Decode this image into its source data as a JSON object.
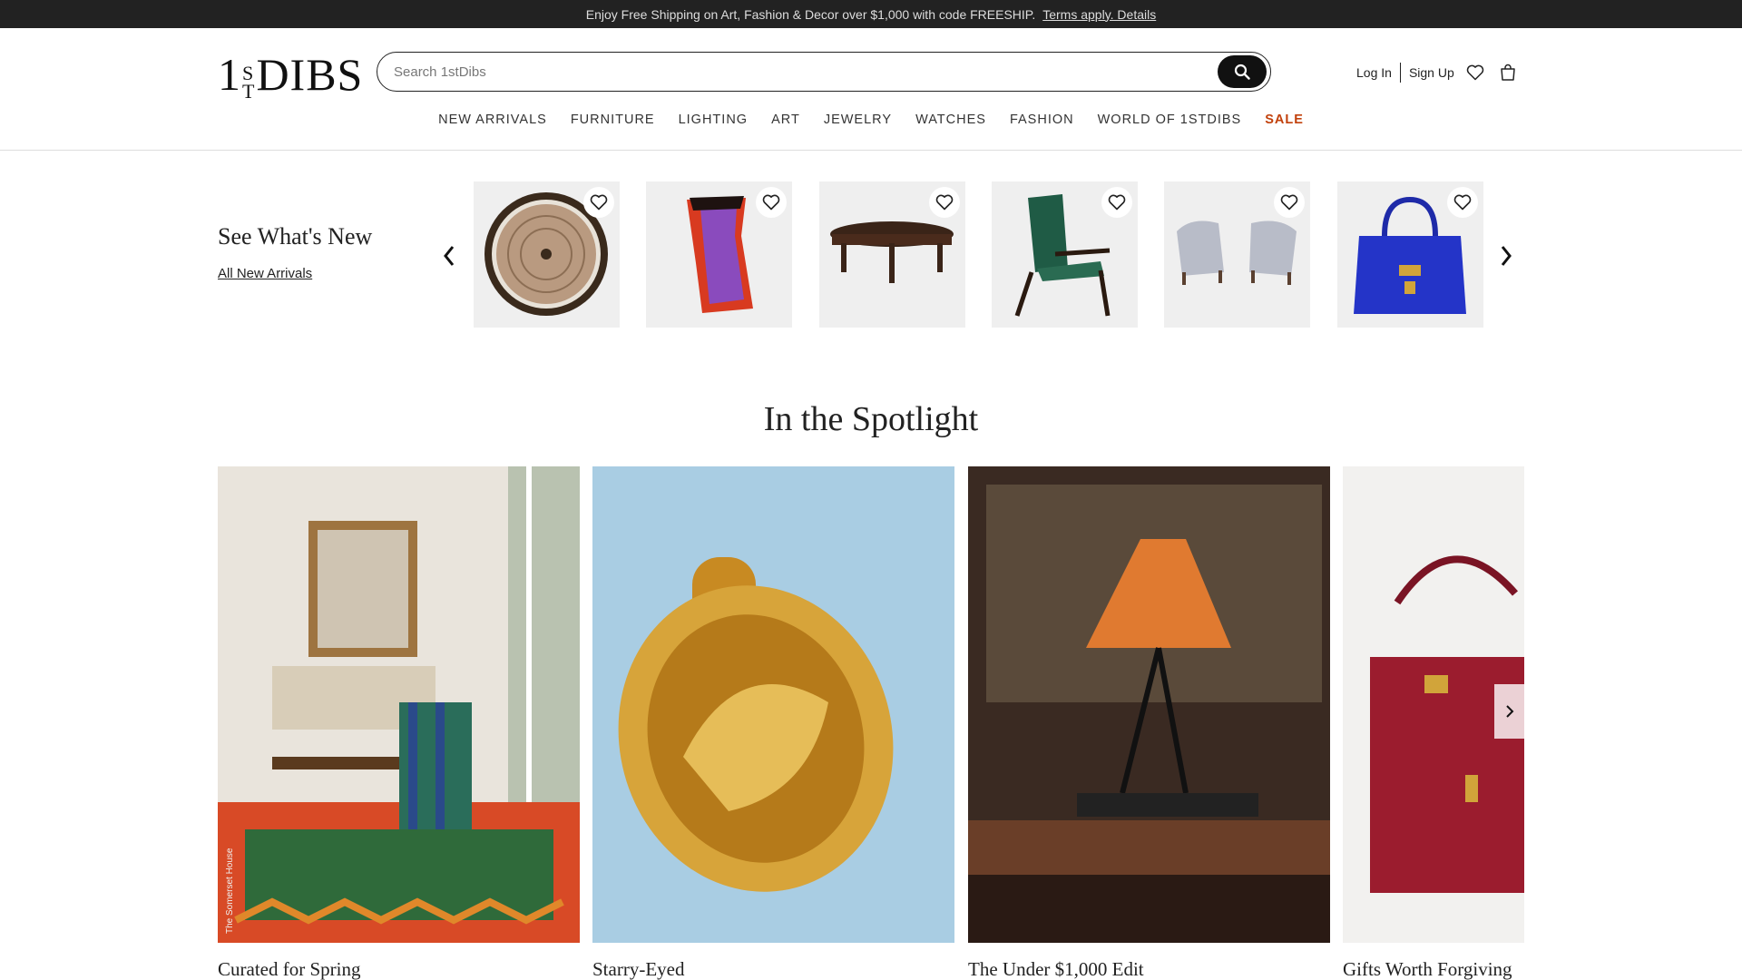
{
  "promo": {
    "text": "Enjoy Free Shipping on Art, Fashion & Decor over $1,000 with code FREESHIP.",
    "link": "Terms apply. Details"
  },
  "header": {
    "logo_main": "1",
    "logo_sup_top": "S",
    "logo_sup_bottom": "T",
    "logo_rest": "DIBS",
    "search_placeholder": "Search 1stDibs",
    "login": "Log In",
    "signup": "Sign Up"
  },
  "nav": [
    "NEW ARRIVALS",
    "FURNITURE",
    "LIGHTING",
    "ART",
    "JEWELRY",
    "WATCHES",
    "FASHION",
    "WORLD OF 1STDIBS",
    "SALE"
  ],
  "new_arrivals": {
    "title": "See What's New",
    "link": "All New Arrivals",
    "items": [
      "Round carved wall plate",
      "Red and purple ceramic vase",
      "Oval dark wood coffee table",
      "Green leather lounge chair",
      "Pair of gray striped armchairs",
      "Blue leather handbag"
    ]
  },
  "spotlight": {
    "title": "In the Spotlight",
    "cards": [
      {
        "label": "Curated for Spring",
        "credit": "The Somerset House"
      },
      {
        "label": "Starry-Eyed"
      },
      {
        "label": "The Under $1,000 Edit"
      },
      {
        "label": "Gifts Worth Forgiving"
      }
    ]
  },
  "colors": {
    "promo_bg": "#222222",
    "sale": "#c2410c",
    "jewel_bg": "#a9cde3",
    "bag_red": "#9b1c2e",
    "bag_blue": "#2434c8"
  }
}
